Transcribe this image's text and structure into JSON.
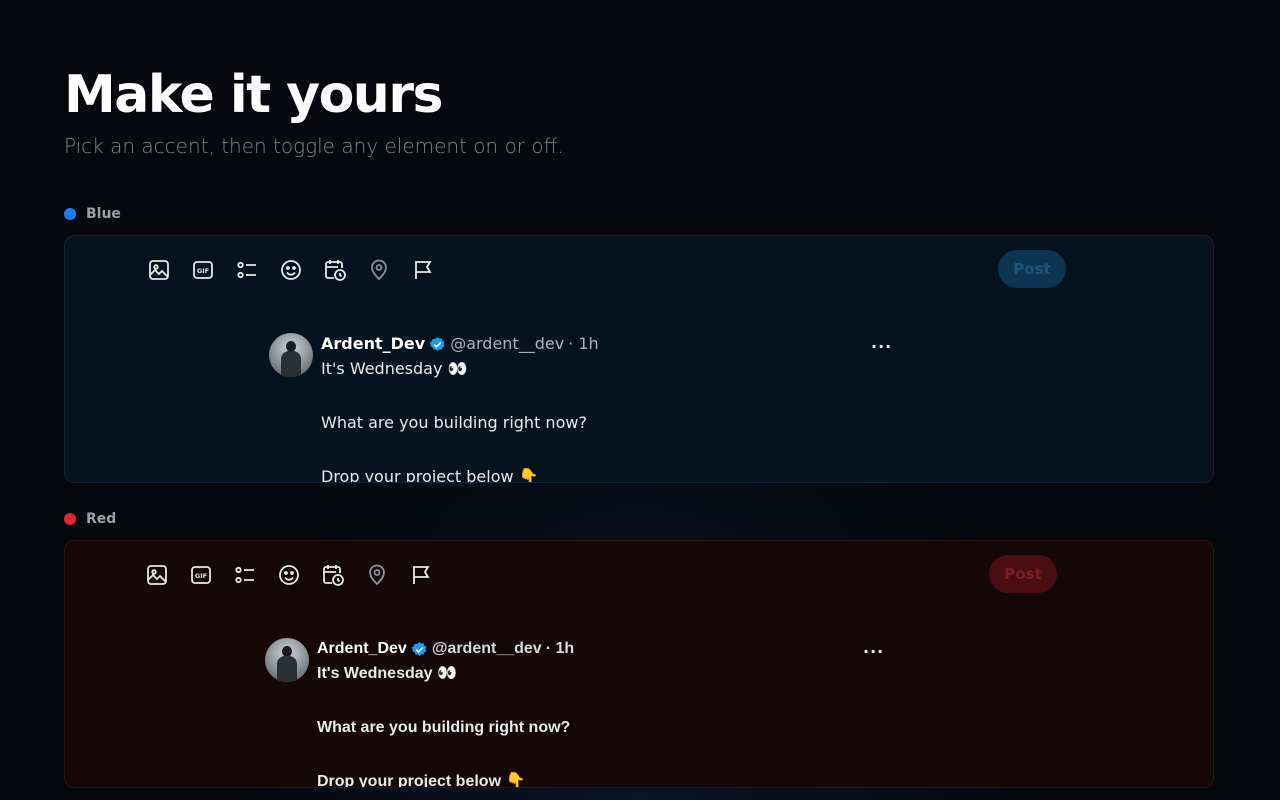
{
  "hero": {
    "title": "Make it yours",
    "subtitle": "Pick an accent, then toggle any element on or off."
  },
  "accents": [
    {
      "name": "Blue",
      "color": "#1d7cf2",
      "post_label": "Post",
      "tweet": {
        "display_name": "Ardent_Dev",
        "handle": "@ardent__dev",
        "time": "· 1h",
        "more": "···",
        "lines": [
          "It's Wednesday 👀",
          "What are you building right now?",
          "Drop your project below 👇"
        ]
      }
    },
    {
      "name": "Red",
      "color": "#e0262f",
      "post_label": "Post",
      "tweet": {
        "display_name": "Ardent_Dev",
        "handle": "@ardent__dev",
        "time": "· 1h",
        "more": "···",
        "lines": [
          "It's Wednesday 👀",
          "What are you building right now?",
          "Drop your project below 👇"
        ]
      }
    }
  ],
  "toolbar_icons": [
    "image-icon",
    "gif-icon",
    "poll-icon",
    "emoji-icon",
    "schedule-icon",
    "location-icon",
    "flag-icon"
  ],
  "verified_color": "#1d9bf0"
}
